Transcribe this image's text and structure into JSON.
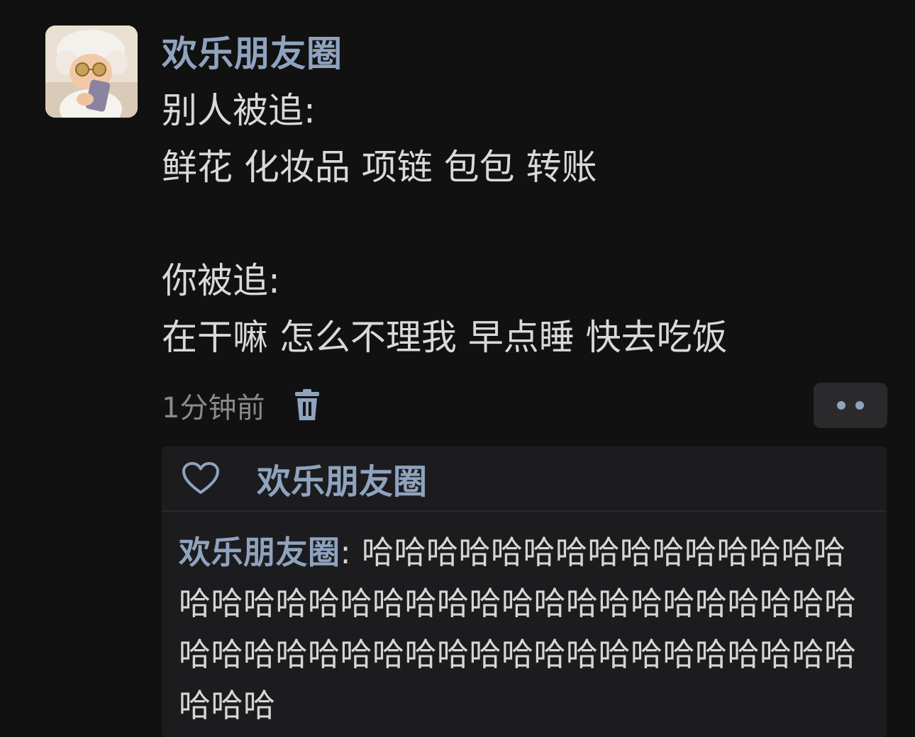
{
  "post": {
    "author": "欢乐朋友圈",
    "lines": [
      "别人被追:",
      "鲜花 化妆品 项链 包包 转账",
      "",
      "你被追:",
      "在干嘛 怎么不理我 早点睡 快去吃饭"
    ],
    "timestamp": "1分钟前"
  },
  "interactions": {
    "liked_by": "欢乐朋友圈",
    "comments": [
      {
        "author": "欢乐朋友圈",
        "separator": ": ",
        "text": "哈哈哈哈哈哈哈哈哈哈哈哈哈哈哈哈哈哈哈哈哈哈哈哈哈哈哈哈哈哈哈哈哈哈哈哈哈哈哈哈哈哈哈哈哈哈哈哈哈哈哈哈哈哈哈哈哈哈哈哈"
      }
    ]
  },
  "icons": {
    "delete": "trash-icon",
    "more": "more-dots-icon",
    "like": "heart-icon"
  },
  "colors": {
    "background": "#111111",
    "name_accent": "#8fa3bf",
    "body_text": "#d9d9d9",
    "muted_text": "#8a8a8a",
    "panel": "#1c1c1e"
  }
}
